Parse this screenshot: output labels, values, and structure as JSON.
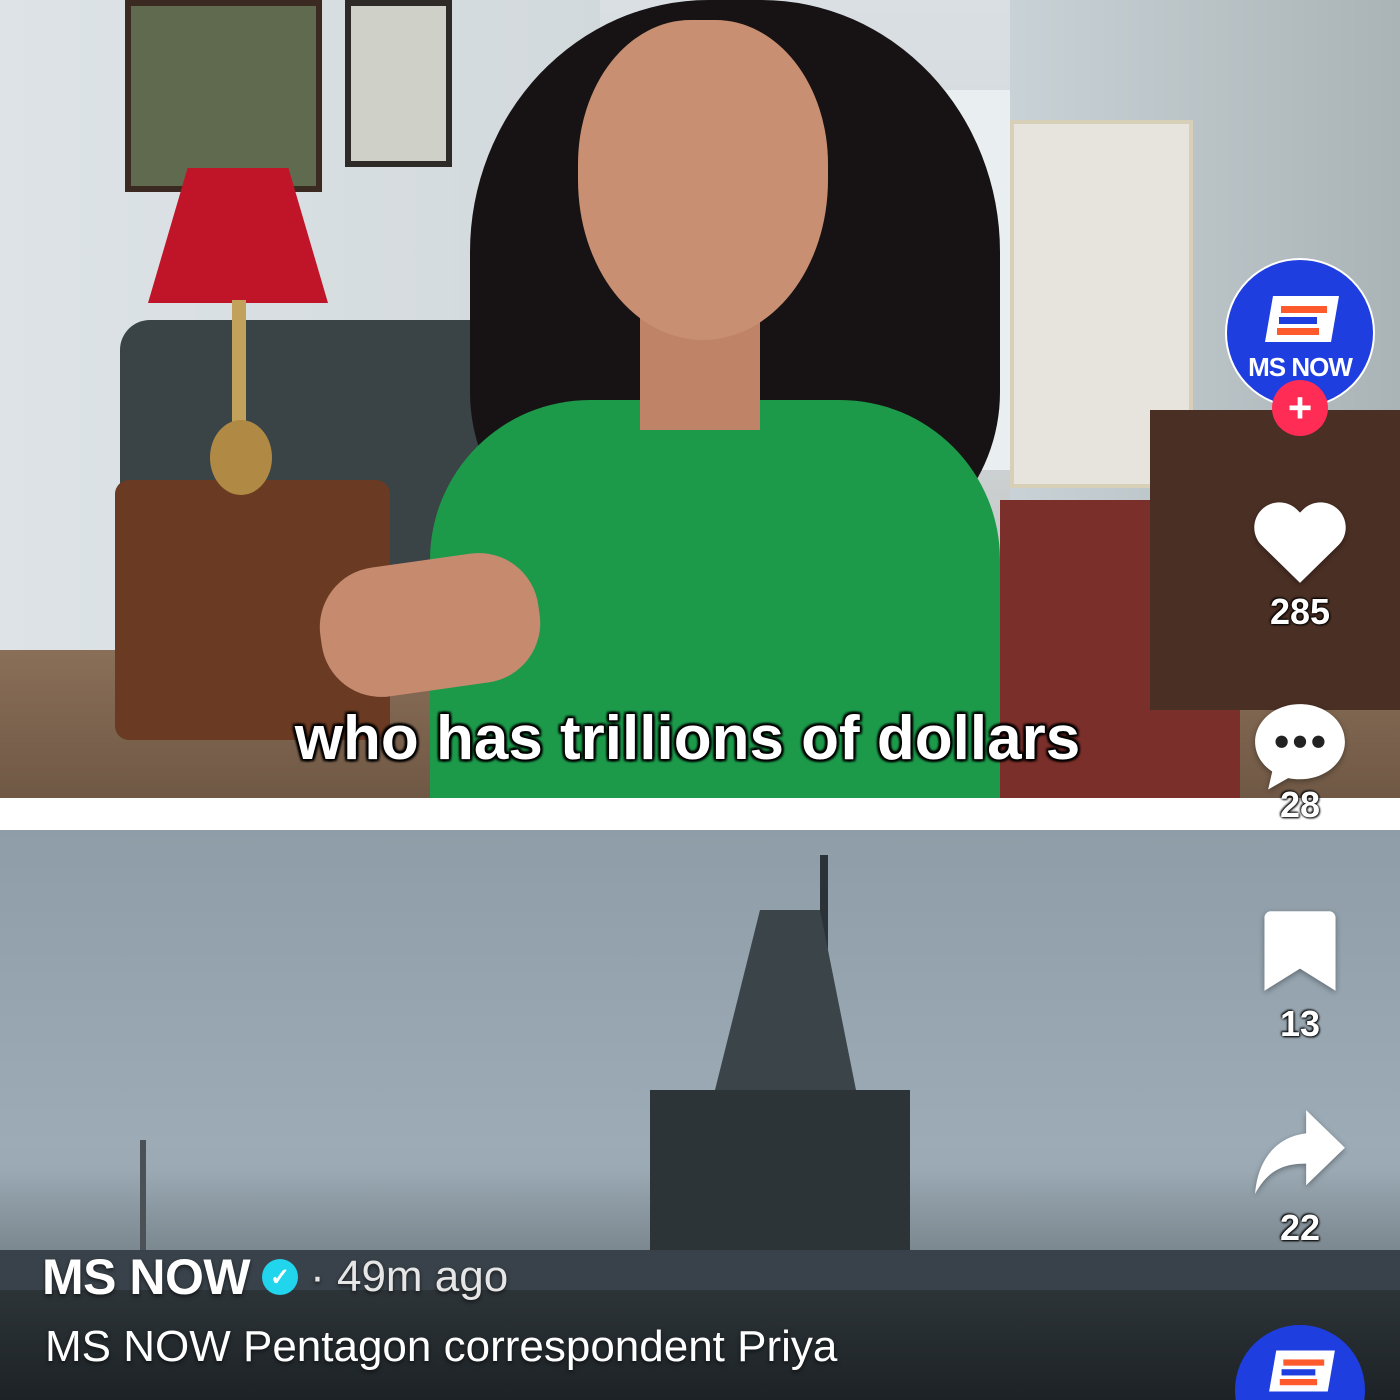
{
  "video": {
    "caption": "who has trillions of dollars"
  },
  "post": {
    "account_name": "MS NOW",
    "posted_ago": "· 49m ago",
    "description": "MS NOW Pentagon correspondent Priya"
  },
  "rail": {
    "avatar_label": "MS NOW",
    "follow_symbol": "+",
    "likes": "285",
    "comments": "28",
    "saves": "13",
    "shares": "22"
  },
  "colors": {
    "brand_blue": "#1f3ee0",
    "brand_orange": "#ff5a2c",
    "follow_red": "#ff2c55",
    "verified_cyan": "#20d5ec"
  },
  "icons": {
    "verified": "check-badge-icon",
    "like": "heart-icon",
    "comment": "speech-bubble-icon",
    "save": "bookmark-icon",
    "share": "share-arrow-icon"
  }
}
